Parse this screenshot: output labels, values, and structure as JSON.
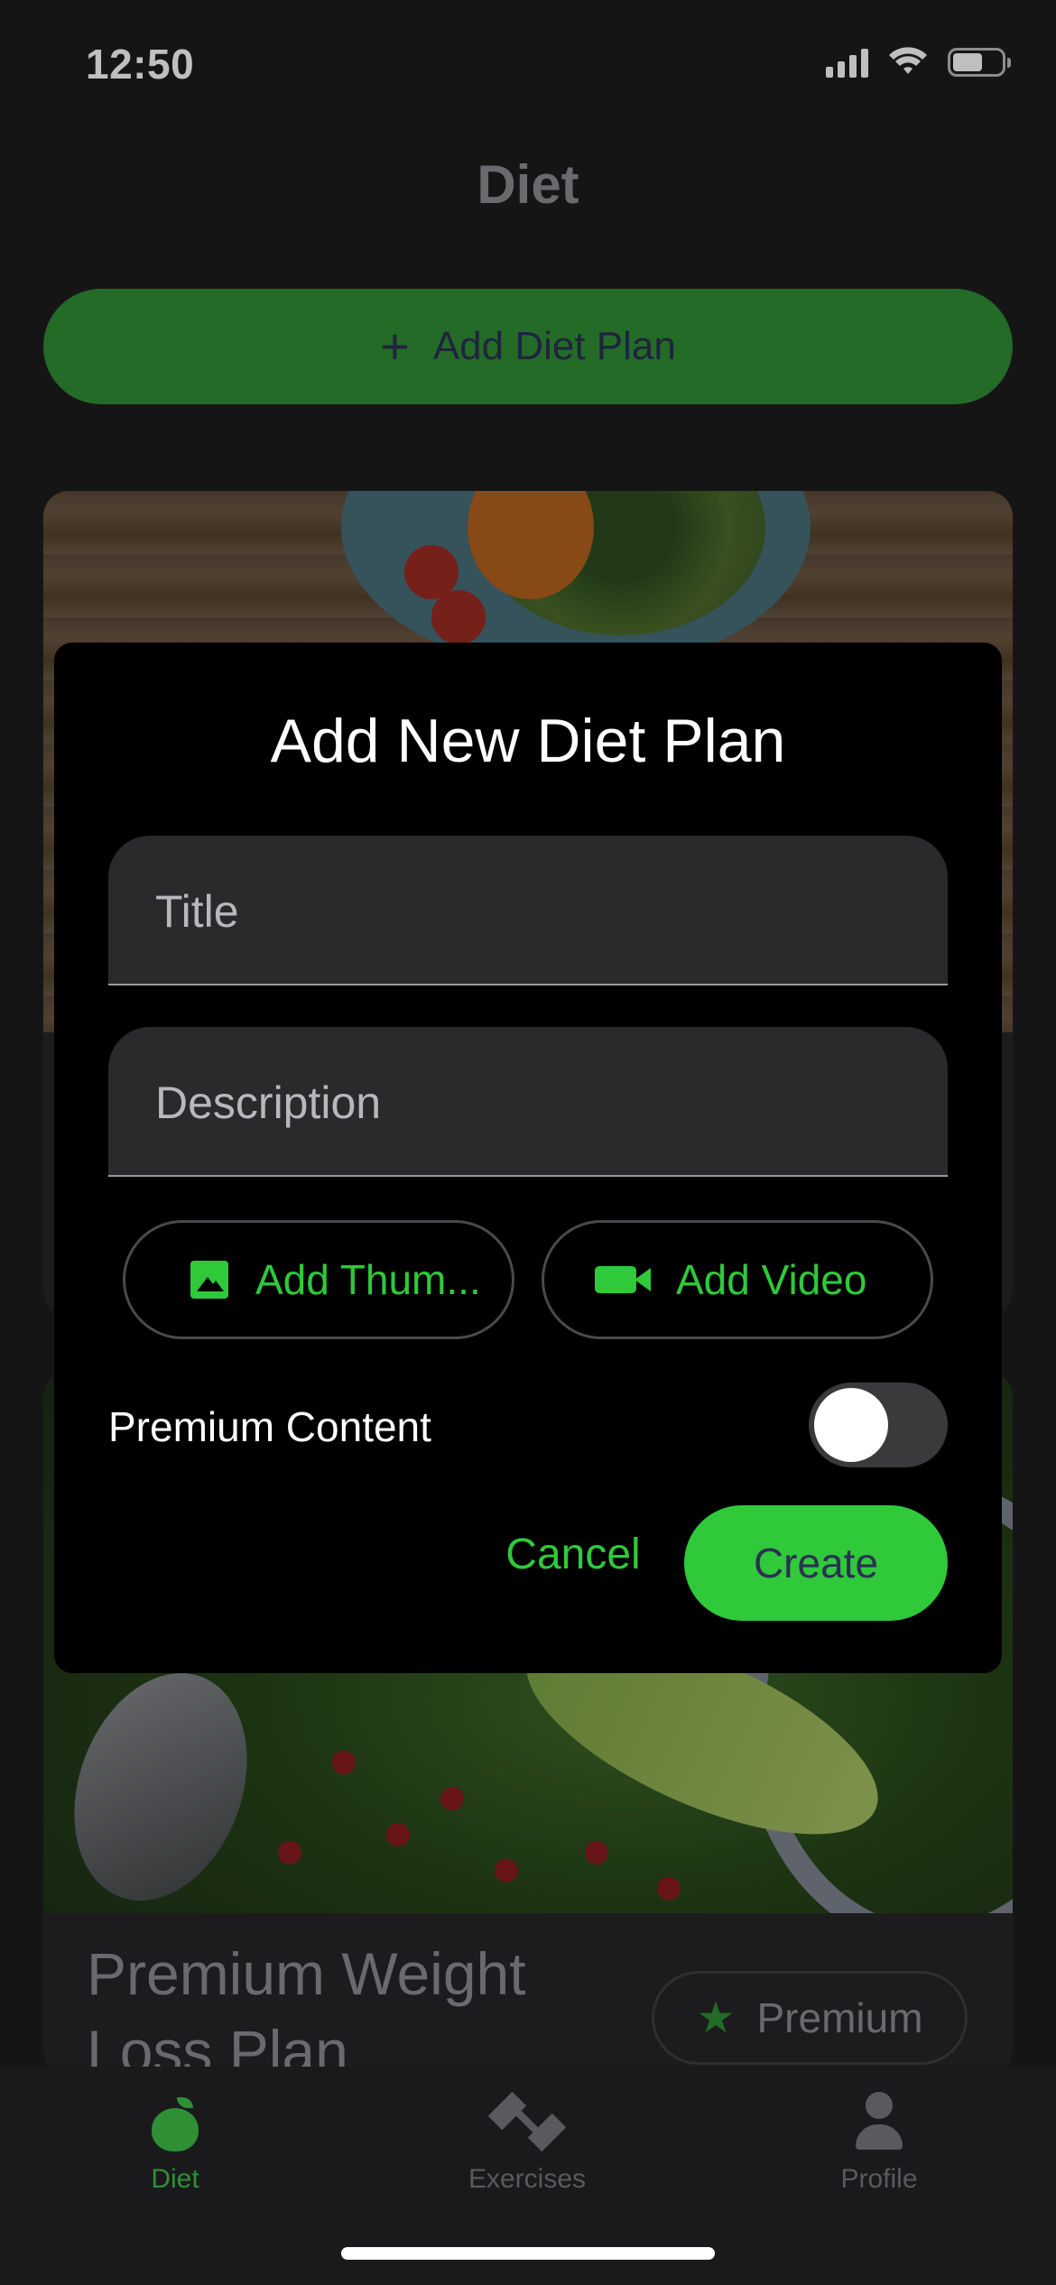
{
  "status_bar": {
    "time": "12:50",
    "icons": [
      "cellular-signal-icon",
      "wifi-icon",
      "battery-icon"
    ]
  },
  "header": {
    "title": "Diet"
  },
  "add_plan_button": {
    "icon": "plus-icon",
    "label": "Add Diet Plan"
  },
  "cards": [
    {
      "title": "Premium Weight Loss Plan",
      "badge": "Premium",
      "badge_icon": "star-icon"
    }
  ],
  "modal": {
    "title": "Add New Diet Plan",
    "title_field": {
      "placeholder": "Title",
      "value": ""
    },
    "description_field": {
      "placeholder": "Description",
      "value": ""
    },
    "add_thumbnail_label": "Add Thum...",
    "add_thumbnail_icon": "image-icon",
    "add_video_label": "Add Video",
    "add_video_icon": "video-camera-icon",
    "premium_label": "Premium Content",
    "premium_enabled": false,
    "cancel_label": "Cancel",
    "create_label": "Create"
  },
  "tab_bar": {
    "tabs": [
      {
        "label": "Diet",
        "icon": "apple-icon",
        "active": true
      },
      {
        "label": "Exercises",
        "icon": "dumbbell-icon",
        "active": false
      },
      {
        "label": "Profile",
        "icon": "person-icon",
        "active": false
      }
    ]
  },
  "colors": {
    "accent_green": "#2fc93a",
    "dim_green": "#2f8f34",
    "background": "#1c1c1e",
    "modal_background": "#000000",
    "button_text": "#2b3153"
  }
}
